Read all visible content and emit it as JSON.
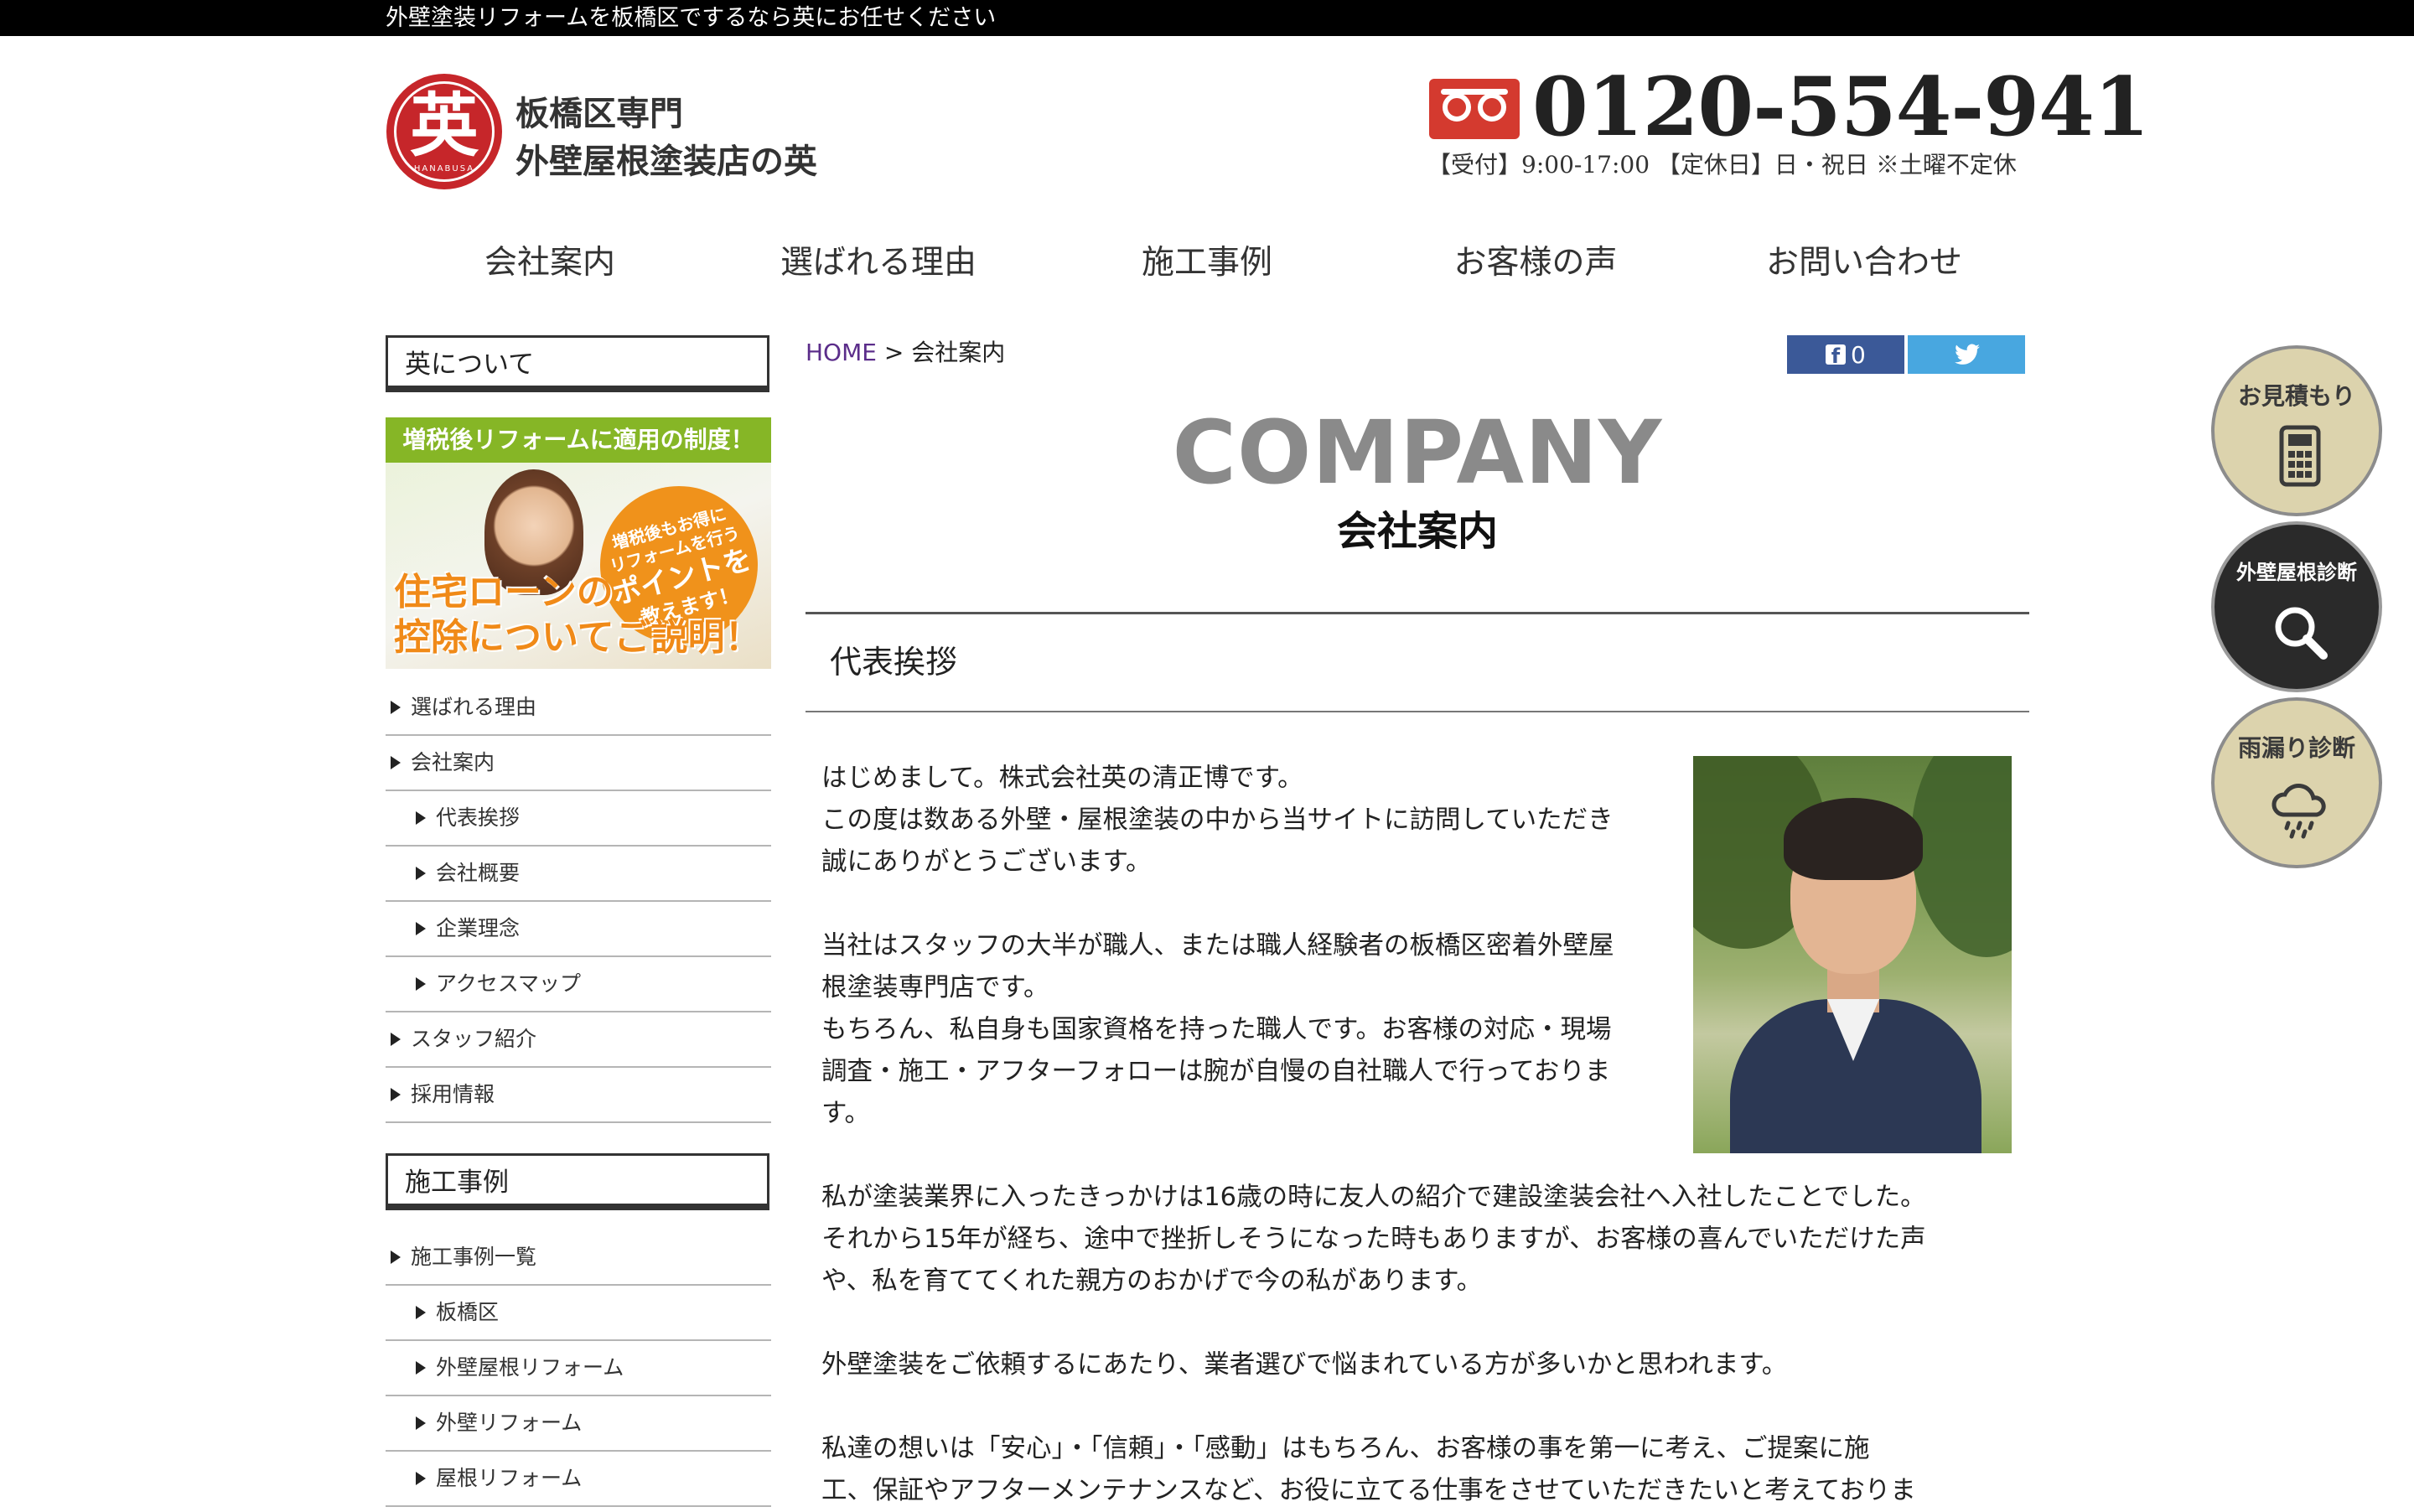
{
  "topbar": {
    "text": "外壁塗装リフォームを板橋区でするなら英にお任せください"
  },
  "logo": {
    "kanji": "英",
    "roman": "HANABUSA",
    "line1": "板橋区専門",
    "line2": "外壁屋根塗装店の英"
  },
  "contact": {
    "phone": "0120-554-941",
    "hours": "【受付】9:00-17:00 【定休日】日・祝日 ※土曜不定休"
  },
  "nav": {
    "items": [
      {
        "label": "会社案内"
      },
      {
        "label": "選ばれる理由"
      },
      {
        "label": "施工事例"
      },
      {
        "label": "お客様の声"
      },
      {
        "label": "お問い合わせ"
      }
    ]
  },
  "sidebar": {
    "about_heading": "英について",
    "banner": {
      "top": "増税後リフォームに適用の制度！",
      "badge_line1": "増税後もお得に",
      "badge_line2": "リフォームを行う",
      "badge_line3": "ポイントを",
      "badge_line4": "教えます！",
      "bottom_line1": "住宅ローンの",
      "bottom_line2": "控除についてご説明！"
    },
    "about_links": [
      {
        "label": "選ばれる理由"
      },
      {
        "label": "会社案内"
      },
      {
        "label": "代表挨拶"
      },
      {
        "label": "会社概要"
      },
      {
        "label": "企業理念"
      },
      {
        "label": "アクセスマップ"
      },
      {
        "label": "スタッフ紹介"
      },
      {
        "label": "採用情報"
      }
    ],
    "cases_heading": "施工事例",
    "case_links": [
      {
        "label": "施工事例一覧"
      },
      {
        "label": "板橋区"
      },
      {
        "label": "外壁屋根リフォーム"
      },
      {
        "label": "外壁リフォーム"
      },
      {
        "label": "屋根リフォーム"
      }
    ]
  },
  "breadcrumb": {
    "home": "HOME",
    "sep": ">",
    "current": "会社案内"
  },
  "share": {
    "fb_count": "0"
  },
  "page": {
    "title": "COMPANY",
    "subtitle": "会社案内"
  },
  "section": {
    "heading": "代表挨拶",
    "lines": [
      "はじめまして。株式会社英の清正博です。",
      "この度は数ある外壁・屋根塗装の中から当サイトに訪問していただき",
      "誠にありがとうございます。",
      "当社はスタッフの大半が職人、または職人経験者の板橋区密着外壁屋",
      "根塗装専門店です。",
      "もちろん、私自身も国家資格を持った職人です。お客様の対応・現場",
      "調査・施工・アフターフォローは腕が自慢の自社職人で行っておりま",
      "す。",
      "私が塗装業界に入ったきっかけは16歳の時に友人の紹介で建設塗装会社へ入社したことでした。",
      "それから15年が経ち、途中で挫折しそうになった時もありますが、お客様の喜んでいただけた声",
      "や、私を育ててくれた親方のおかげで今の私があります。",
      "外壁塗装をご依頼するにあたり、業者選びで悩まれている方が多いかと思われます。",
      "私達の想いは「安心」・「信頼」・「感動」はもちろん、お客様の事を第一に考え、ご提案に施",
      "工、保証やアフターメンテナンスなど、お役に立てる仕事をさせていただきたいと考えておりま"
    ]
  },
  "floating": {
    "estimate": "お見積もり",
    "diagnosis": "外壁屋根診断",
    "leak": "雨漏り診断"
  }
}
